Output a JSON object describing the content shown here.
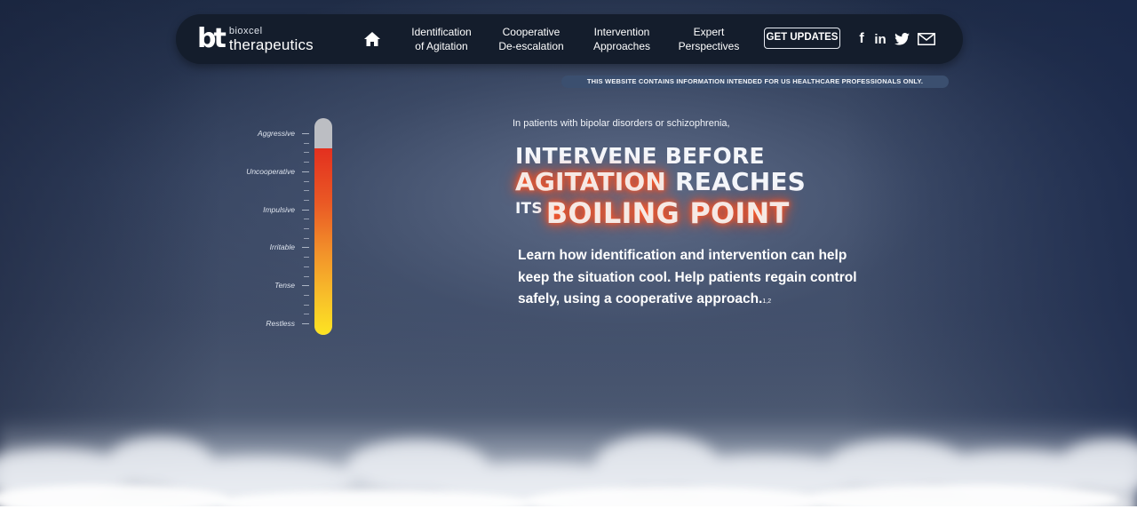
{
  "nav": {
    "logo_mark": "bt",
    "logo_top": "bioxcel",
    "logo_bottom": "therapeutics",
    "home_icon": "home-icon",
    "links": [
      {
        "line1": "Identification",
        "line2": "of Agitation"
      },
      {
        "line1": "Cooperative",
        "line2": "De-escalation"
      },
      {
        "line1": "Intervention",
        "line2": "Approaches"
      },
      {
        "line1": "Expert",
        "line2": "Perspectives"
      }
    ],
    "cta_label": "GET UPDATES",
    "social": {
      "facebook": "f",
      "linkedin": "in",
      "twitter_icon": "twitter-icon",
      "mail_icon": "mail-icon"
    }
  },
  "disclaimer": "THIS WEBSITE CONTAINS INFORMATION INTENDED FOR US HEALTHCARE PROFESSIONALS ONLY.",
  "thermometer": {
    "levels": [
      "Aggressive",
      "Uncooperative",
      "Impulsive",
      "Irritable",
      "Tense",
      "Restless"
    ],
    "fill_fraction": 0.86,
    "fill_colors": [
      "#e3301f",
      "#fde422"
    ]
  },
  "hero": {
    "intro": "In patients with bipolar disorders or schizophrenia,",
    "headline": {
      "line1": "INTERVENE BEFORE",
      "line2_hot": "AGITATION",
      "line2_rest": " REACHES",
      "line3_small": "ITS",
      "line3_hot": "BOILING POINT"
    },
    "body": "Learn how identification and intervention can help keep the situation cool. Help patients regain control safely, using a cooperative approach.",
    "refs": "1,2"
  },
  "colors": {
    "nav_bg": "#141d2c",
    "glow": "#ff5a2a"
  }
}
